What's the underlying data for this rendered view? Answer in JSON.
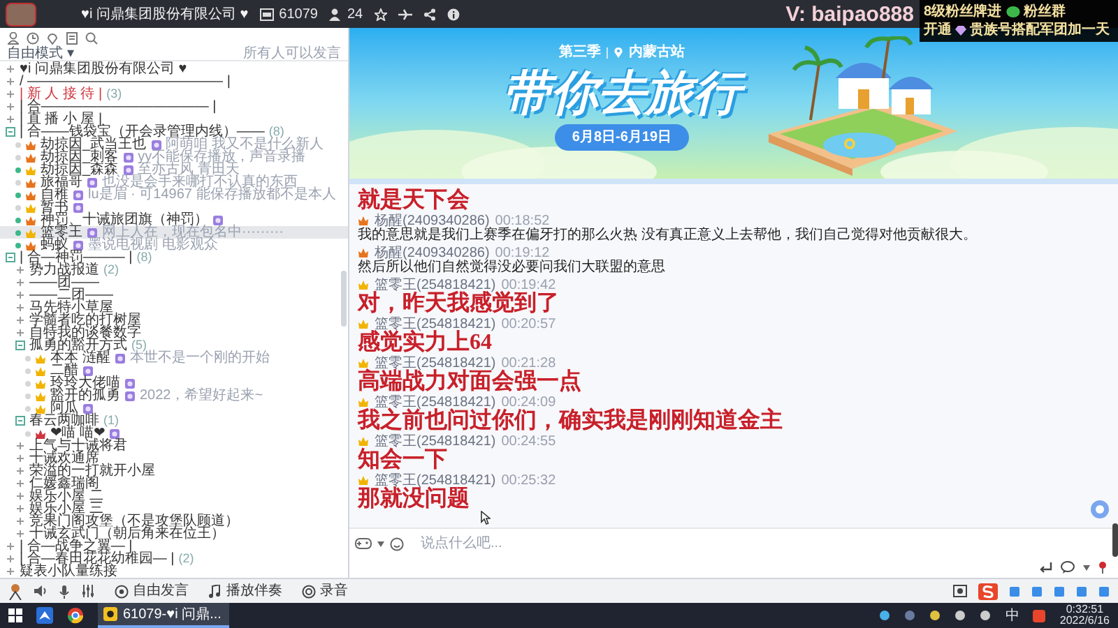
{
  "header": {
    "channel_title": "♥i 问鼎集团股份有限公司 ♥",
    "viewers": "61079",
    "online": "24"
  },
  "overlay": {
    "handle": "V: baipao888",
    "line_1": [
      "8级粉丝牌进",
      "粉丝群"
    ],
    "line_2": [
      "开通",
      "贵族号搭配军团加一天"
    ]
  },
  "sidebar": {
    "mode": "自由模式",
    "mode_caret": "▾",
    "speak_rule": "所有人可以发言",
    "tree": [
      {
        "kind": "channel",
        "label": "♥i    问鼎集团股份有限公司    ♥",
        "expanded": false
      },
      {
        "kind": "channel",
        "label": "/ —————————————— |",
        "expanded": false
      },
      {
        "kind": "channel",
        "label": "|    新 人 接 待          |",
        "count": "(3)",
        "expanded": false,
        "color": "#d0353f"
      },
      {
        "kind": "channel",
        "label": "|  合———————————— |",
        "expanded": false
      },
      {
        "kind": "channel",
        "label": "|    直 播 小 屋          |",
        "expanded": false
      },
      {
        "kind": "channel",
        "label": "|  合——钱袋宝（开会录管理内线）——",
        "count": "(8)",
        "expanded": true,
        "children": [
          {
            "kind": "user",
            "name": "劫掠因_武当王也",
            "note": "阿萌咱 我又不是什么新人",
            "online": false,
            "selected": false,
            "color": "#e8741c"
          },
          {
            "kind": "user",
            "name": "劫掠因_刺客",
            "note": "yy不能保存播放，声音录播",
            "online": false,
            "selected": false,
            "color": "#e8741c"
          },
          {
            "kind": "user",
            "name": "劫掠因_森森",
            "note": "至亦古风 青田天",
            "online": true,
            "selected": false,
            "color": "#f2b400"
          },
          {
            "kind": "user",
            "name": "旅福哥",
            "note": "也没是会手来哪打不认真的东西",
            "online": false,
            "selected": false,
            "color": "#e8741c"
          },
          {
            "kind": "user",
            "name": "自稚",
            "note": "lu是眉 · 可14967 能保存播放都不是本人",
            "online": true,
            "selected": false,
            "color": "#e8741c"
          },
          {
            "kind": "user",
            "name": "暂书",
            "online": false,
            "selected": false,
            "color": "#f2b400"
          },
          {
            "kind": "user",
            "name": "神罚、十诫旅团旗（神罚）",
            "online": true,
            "selected": false,
            "color": "#e8741c"
          },
          {
            "kind": "user",
            "name": "篮零王",
            "note": "网上人在，现在包名中·········",
            "online": true,
            "selected": true,
            "color": "#f2b400"
          },
          {
            "kind": "user",
            "name": "蚂蚁",
            "note": "墨说电视剧 电影观众",
            "online": true,
            "selected": false,
            "color": "#e8741c"
          }
        ]
      },
      {
        "kind": "channel",
        "label": "|     合—神罚———   |",
        "count": "(8)",
        "expanded": true,
        "children": [
          {
            "kind": "channel",
            "label": "势力战报道",
            "count": "(2)",
            "expanded": false
          },
          {
            "kind": "channel",
            "label": "——团——",
            "expanded": false
          },
          {
            "kind": "channel",
            "label": "——二团——",
            "expanded": false
          },
          {
            "kind": "channel",
            "label": "马先特小草屋",
            "expanded": false
          },
          {
            "kind": "channel",
            "label": "学髓者吃的打树屋",
            "expanded": false
          },
          {
            "kind": "channel",
            "label": "自特我的谈餐数字",
            "expanded": false
          },
          {
            "kind": "channel",
            "label": "孤勇的豁开方式",
            "count": "(5)",
            "expanded": true,
            "children": [
              {
                "kind": "user",
                "name": "本本 涟醒",
                "note": "本世不是一个刚的开始",
                "online": false,
                "selected": false,
                "color": "#f2b400"
              },
              {
                "kind": "user",
                "name": "二醋",
                "online": false,
                "selected": false,
                "color": "#f2b400"
              },
              {
                "kind": "user",
                "name": "玲玲大佬喵",
                "online": false,
                "selected": false,
                "color": "#f2b400"
              },
              {
                "kind": "user",
                "name": "豁开的孤勇",
                "note": "2022，希望好起来~",
                "online": false,
                "selected": false,
                "color": "#f2b400"
              },
              {
                "kind": "user",
                "name": "阿瓜",
                "online": false,
                "selected": false,
                "color": "#f2b400"
              }
            ]
          },
          {
            "kind": "channel",
            "label": "春云两咖啡",
            "count": "(1)",
            "expanded": true,
            "children": [
              {
                "kind": "user",
                "name": "❤喵 喵❤",
                "online": false,
                "selected": false,
                "color": "#d0353f"
              }
            ]
          },
          {
            "kind": "channel",
            "label": "上气与十诫将君",
            "expanded": false
          },
          {
            "kind": "channel",
            "label": "十诫欢通席",
            "expanded": false
          },
          {
            "kind": "channel",
            "label": "荣溢的一打就开小屋",
            "expanded": false
          },
          {
            "kind": "channel",
            "label": "仁媛鑫瑞阁",
            "expanded": false
          },
          {
            "kind": "channel",
            "label": "娱乐小屋 二",
            "expanded": false
          },
          {
            "kind": "channel",
            "label": "娱乐小屋 三",
            "expanded": false
          },
          {
            "kind": "channel",
            "label": "竞果门阁攻堡（不是攻堡队顾道）",
            "expanded": false
          },
          {
            "kind": "channel",
            "label": "十诫玄武门（朝后角来在位王）",
            "expanded": false
          }
        ]
      },
      {
        "kind": "channel",
        "label": "|     合—战争之翼—       |",
        "expanded": false
      },
      {
        "kind": "channel",
        "label": "|     合—春田花花幼稚园— |",
        "count": "(2)",
        "expanded": false
      },
      {
        "kind": "channel",
        "label": "疑表小队量练接",
        "expanded": false
      }
    ]
  },
  "banner": {
    "season": "第三季",
    "location": "内蒙古站",
    "title": "带你去旅行",
    "dates": "6月8日-6月19日"
  },
  "chat": {
    "messages": [
      {
        "kind": "emphasis",
        "text": "就是天下会"
      },
      {
        "kind": "plain",
        "name": "杨醒(2409340286)",
        "time": "00:18:52",
        "color": "#e8741c",
        "text": "我的意思就是我们上赛季在偏牙打的那么火热 没有真正意义上去帮他，我们自己觉得对他贡献很大。"
      },
      {
        "kind": "plain",
        "name": "杨醒(2409340286)",
        "time": "00:19:12",
        "color": "#e8741c",
        "text": "然后所以他们自然觉得没必要问我们大联盟的意思"
      },
      {
        "kind": "emphasis",
        "name": "篮零王(254818421)",
        "time": "00:19:42",
        "color": "#f2b400",
        "text": "对，昨天我感觉到了"
      },
      {
        "kind": "emphasis",
        "name": "篮零王(254818421)",
        "time": "00:20:57",
        "color": "#f2b400",
        "text": "感觉实力上64"
      },
      {
        "kind": "emphasis",
        "name": "篮零王(254818421)",
        "time": "00:21:28",
        "color": "#f2b400",
        "text": "高端战力对面会强一点"
      },
      {
        "kind": "emphasis",
        "name": "篮零王(254818421)",
        "time": "00:24:09",
        "color": "#f2b400",
        "text": "我之前也问过你们，确实我是刚刚知道金主"
      },
      {
        "kind": "emphasis",
        "name": "篮零王(254818421)",
        "time": "00:24:55",
        "color": "#f2b400",
        "text": "知会一下"
      },
      {
        "kind": "emphasis",
        "name": "篮零王(254818421)",
        "time": "00:25:32",
        "color": "#f2b400",
        "text": "那就没问题"
      }
    ],
    "input": {
      "placeholder": "说点什么吧..."
    }
  },
  "bottom_bar": {
    "items": [
      "自由发言",
      "播放伴奏",
      "录音"
    ]
  },
  "taskbar": {
    "task": "61079-♥i 问鼎...",
    "ime": "中",
    "time": "0:32:51",
    "date": "2022/6/16"
  }
}
